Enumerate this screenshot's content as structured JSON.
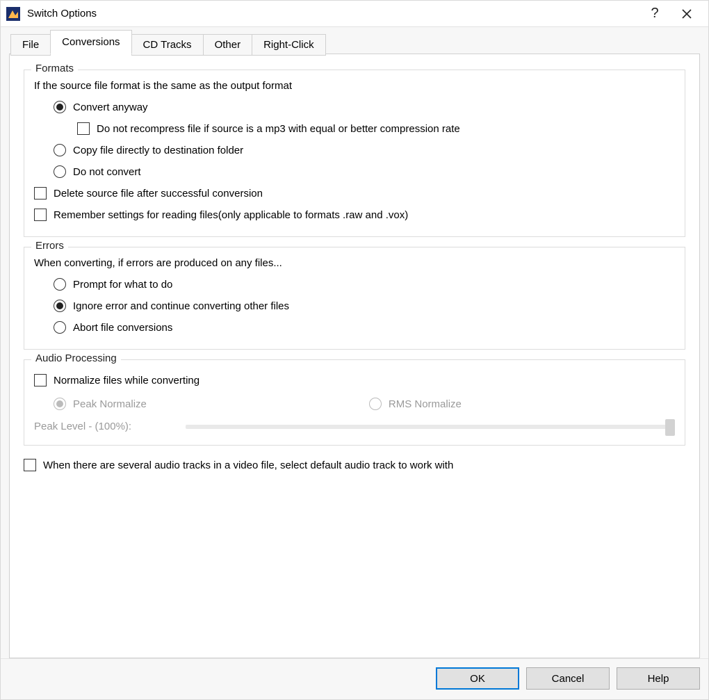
{
  "window": {
    "title": "Switch Options"
  },
  "tabs": {
    "file": "File",
    "conversions": "Conversions",
    "cdtracks": "CD Tracks",
    "other": "Other",
    "rightclick": "Right-Click",
    "active": "conversions"
  },
  "formats": {
    "title": "Formats",
    "desc": "If the source file format is the same as the output format",
    "radio_convert_anyway": "Convert anyway",
    "check_no_recompress": "Do not recompress file if source is a mp3 with equal or better compression rate",
    "radio_copy_direct": "Copy file directly to destination folder",
    "radio_do_not_convert": "Do not convert",
    "check_delete_source": "Delete source file after successful conversion",
    "check_remember_settings": "Remember settings for reading files(only applicable to formats .raw and .vox)"
  },
  "errors": {
    "title": "Errors",
    "desc": "When converting, if errors are produced on any files...",
    "radio_prompt": "Prompt for what to do",
    "radio_ignore": "Ignore error and continue converting other files",
    "radio_abort": "Abort file conversions"
  },
  "audio": {
    "title": "Audio Processing",
    "check_normalize": "Normalize files while converting",
    "radio_peak": "Peak Normalize",
    "radio_rms": "RMS Normalize",
    "peak_label": "Peak Level - (100%):"
  },
  "bottom_check": "When there are several audio tracks in a video file, select default audio track to work with",
  "buttons": {
    "ok": "OK",
    "cancel": "Cancel",
    "help": "Help"
  }
}
